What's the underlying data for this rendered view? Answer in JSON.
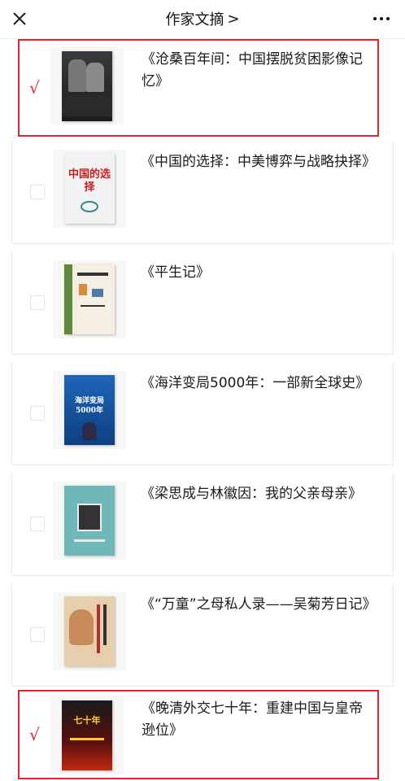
{
  "header": {
    "title": "作家文摘",
    "chevron": ">"
  },
  "icons": {
    "close": "close-icon",
    "more": "more-dots-icon",
    "check": "√"
  },
  "colors": {
    "selection_border": "#e0262a",
    "checkmark": "#e0262a"
  },
  "items": [
    {
      "title": "《沧桑百年间：中国摆脱贫困影像记忆》",
      "selected": true,
      "cover_text": ""
    },
    {
      "title": "《中国的选择：中美博弈与战略抉择》",
      "selected": false,
      "cover_text": "中国的选择"
    },
    {
      "title": "《平生记》",
      "selected": false,
      "cover_text": ""
    },
    {
      "title": "《海洋变局5000年：一部新全球史》",
      "selected": false,
      "cover_text": "海洋变局5000年"
    },
    {
      "title": "《梁思成与林徽因：我的父亲母亲》",
      "selected": false,
      "cover_text": ""
    },
    {
      "title": "《“万童”之母私人录——吴菊芳日记》",
      "selected": false,
      "cover_text": ""
    },
    {
      "title": "《晚清外交七十年：重建中国与皇帝逊位》",
      "selected": true,
      "cover_text": "七十年"
    }
  ]
}
